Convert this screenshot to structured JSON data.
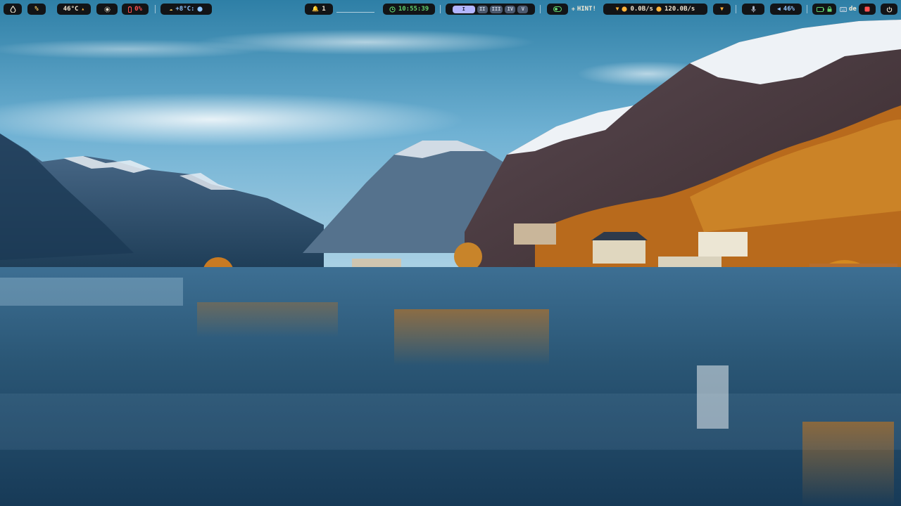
{
  "bar": {
    "launcher_icon": "drop-icon",
    "cpu_usage_text": "%",
    "cpu_temp_text": "46°C",
    "brightness_icon": "sun-icon",
    "battery_text": "0%",
    "weather_text": "+8°C:",
    "notifications_count": "1",
    "clock_text": "10:55:39",
    "workspaces": [
      "I",
      "II",
      "III",
      "IV",
      "V"
    ],
    "active_workspace_index": 0,
    "hint_text": "HINT!",
    "net_down_text": "0.0B/s",
    "net_up_text": "120.0B/s",
    "volume_text": "46%",
    "keyboard_layout_text": "de",
    "colors": {
      "pill_bg": "#121417",
      "text": "#f0e6d2",
      "accent_orange": "#ffb43c",
      "accent_red": "#ff5050",
      "accent_green": "#62d26f",
      "accent_blue": "#8ec5ff",
      "workspace_active": "#b3b5ff",
      "workspace_inactive": "#4c5a70"
    }
  }
}
